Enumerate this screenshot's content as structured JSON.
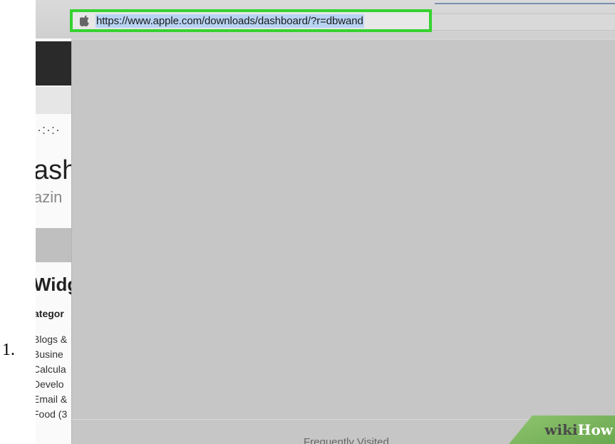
{
  "step": {
    "number": "1."
  },
  "browser": {
    "address_bar": {
      "url": "https://www.apple.com/downloads/dashboard/?r=dbwand",
      "selected": true,
      "icon": "apple-icon"
    },
    "highlight_color": "#35d230"
  },
  "background_page": {
    "heading_fragment": "ash",
    "subtitle_fragment": "azin",
    "section_fragment": "Widg",
    "category_fragment": "ategor",
    "list_fragments": [
      "Blogs &",
      "Busine",
      "Calcula",
      "Develo",
      "Email &",
      "Food (3"
    ]
  },
  "overlay": {
    "footer_label": "Frequently Visited"
  },
  "watermark": {
    "wiki": "wiki",
    "how": "How"
  }
}
